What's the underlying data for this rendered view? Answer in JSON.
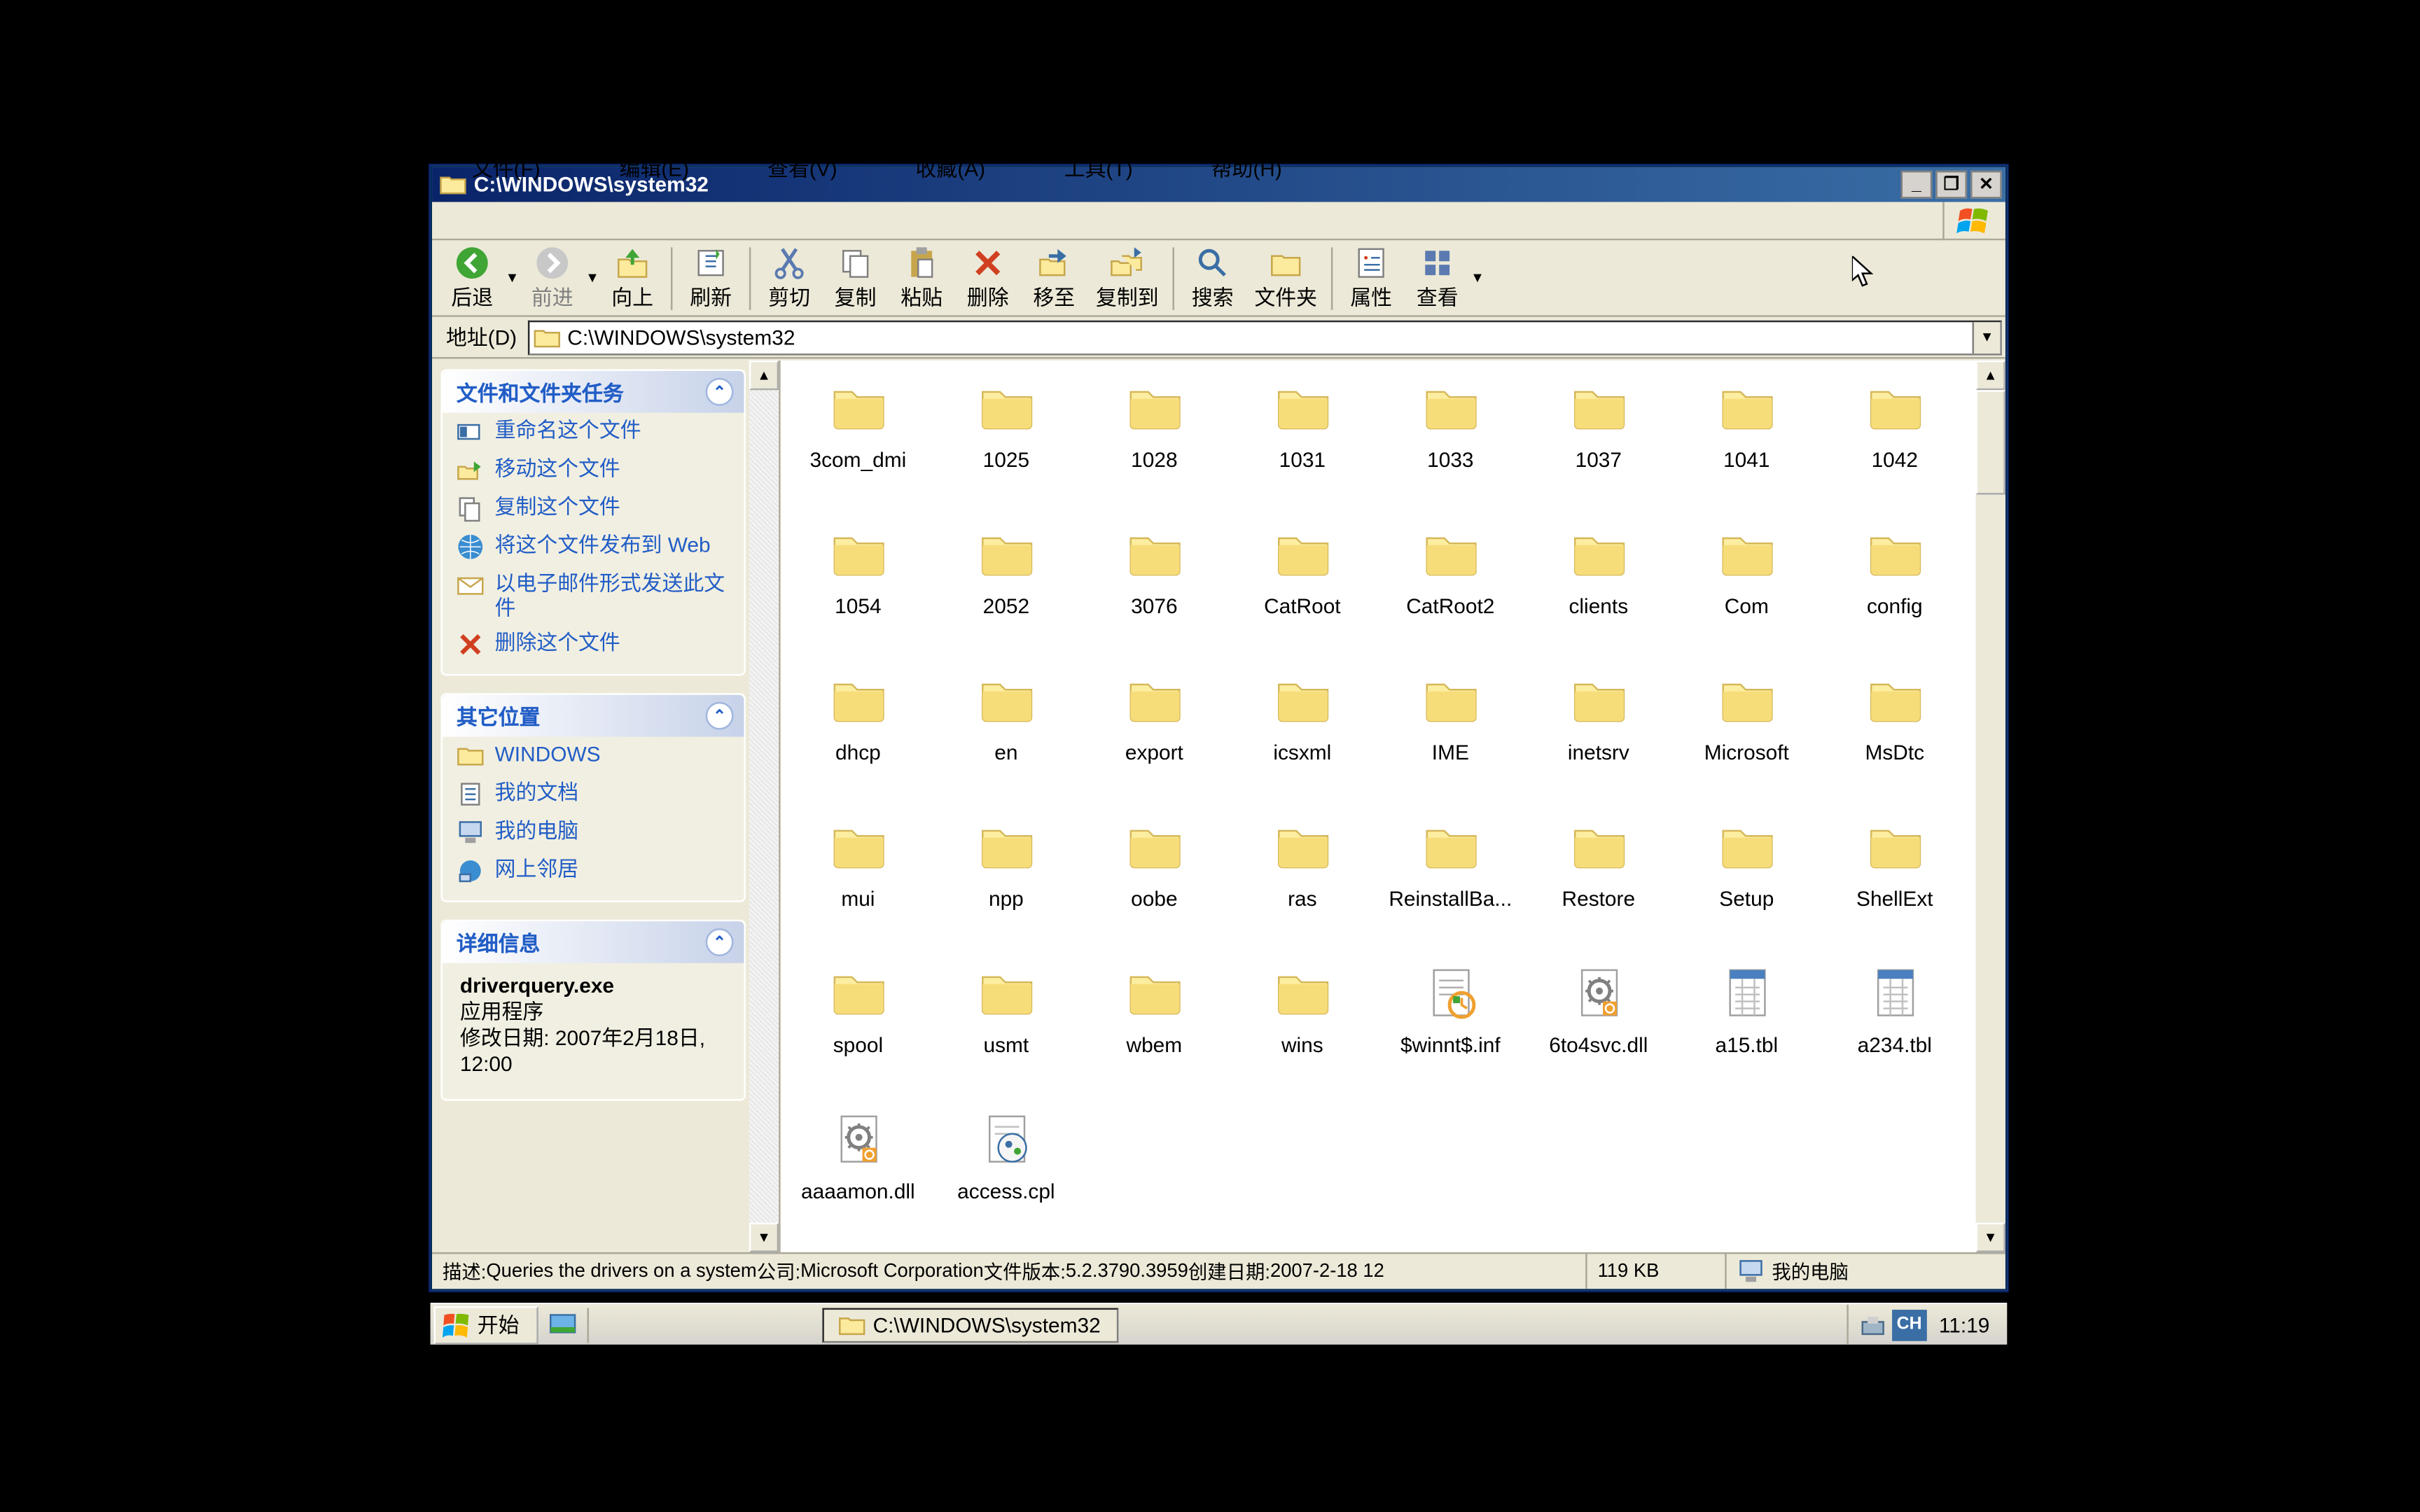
{
  "window": {
    "title": "C:\\WINDOWS\\system32"
  },
  "menu": {
    "file": "文件(F)",
    "edit": "编辑(E)",
    "view": "查看(V)",
    "favorites": "收藏(A)",
    "tools": "工具(T)",
    "help": "帮助(H)"
  },
  "toolbar": {
    "back": "后退",
    "forward": "前进",
    "up": "向上",
    "refresh": "刷新",
    "cut": "剪切",
    "copy": "复制",
    "paste": "粘贴",
    "delete": "删除",
    "moveto": "移至",
    "copyto": "复制到",
    "search": "搜索",
    "folders": "文件夹",
    "properties": "属性",
    "views": "查看"
  },
  "address": {
    "label": "地址(D)",
    "value": "C:\\WINDOWS\\system32"
  },
  "sidebar": {
    "tasks": {
      "title": "文件和文件夹任务",
      "items": [
        "重命名这个文件",
        "移动这个文件",
        "复制这个文件",
        "将这个文件发布到 Web",
        "以电子邮件形式发送此文件",
        "删除这个文件"
      ]
    },
    "places": {
      "title": "其它位置",
      "items": [
        "WINDOWS",
        "我的文档",
        "我的电脑",
        "网上邻居"
      ]
    },
    "details": {
      "title": "详细信息",
      "filename": "driverquery.exe",
      "filetype": "应用程序",
      "modified_label": "修改日期: ",
      "modified": "2007年2月18日, 12:00"
    }
  },
  "folders": [
    {
      "name": "3com_dmi",
      "type": "folder"
    },
    {
      "name": "1025",
      "type": "folder"
    },
    {
      "name": "1028",
      "type": "folder"
    },
    {
      "name": "1031",
      "type": "folder"
    },
    {
      "name": "1033",
      "type": "folder"
    },
    {
      "name": "1037",
      "type": "folder"
    },
    {
      "name": "1041",
      "type": "folder"
    },
    {
      "name": "1042",
      "type": "folder"
    },
    {
      "name": "1054",
      "type": "folder"
    },
    {
      "name": "2052",
      "type": "folder"
    },
    {
      "name": "3076",
      "type": "folder"
    },
    {
      "name": "CatRoot",
      "type": "folder"
    },
    {
      "name": "CatRoot2",
      "type": "folder"
    },
    {
      "name": "clients",
      "type": "folder"
    },
    {
      "name": "Com",
      "type": "folder"
    },
    {
      "name": "config",
      "type": "folder"
    },
    {
      "name": "dhcp",
      "type": "folder"
    },
    {
      "name": "en",
      "type": "folder"
    },
    {
      "name": "export",
      "type": "folder"
    },
    {
      "name": "icsxml",
      "type": "folder"
    },
    {
      "name": "IME",
      "type": "folder"
    },
    {
      "name": "inetsrv",
      "type": "folder"
    },
    {
      "name": "Microsoft",
      "type": "folder"
    },
    {
      "name": "MsDtc",
      "type": "folder"
    },
    {
      "name": "mui",
      "type": "folder"
    },
    {
      "name": "npp",
      "type": "folder"
    },
    {
      "name": "oobe",
      "type": "folder"
    },
    {
      "name": "ras",
      "type": "folder"
    },
    {
      "name": "ReinstallBa...",
      "type": "folder"
    },
    {
      "name": "Restore",
      "type": "folder"
    },
    {
      "name": "Setup",
      "type": "folder"
    },
    {
      "name": "ShellExt",
      "type": "folder"
    },
    {
      "name": "spool",
      "type": "folder"
    },
    {
      "name": "usmt",
      "type": "folder"
    },
    {
      "name": "wbem",
      "type": "folder"
    },
    {
      "name": "wins",
      "type": "folder"
    },
    {
      "name": "$winnt$.inf",
      "type": "inf"
    },
    {
      "name": "6to4svc.dll",
      "type": "dll"
    },
    {
      "name": "a15.tbl",
      "type": "tbl"
    },
    {
      "name": "a234.tbl",
      "type": "tbl"
    },
    {
      "name": "aaaamon.dll",
      "type": "dll"
    },
    {
      "name": "access.cpl",
      "type": "cpl"
    }
  ],
  "statusbar": {
    "desc_label": "描述: ",
    "desc": "Queries the drivers on a system",
    "company_label": " 公司: ",
    "company": "Microsoft Corporation",
    "version_label": " 文件版本: ",
    "version": "5.2.3790.3959",
    "created_label": " 创建日期: ",
    "created": "2007-2-18 12",
    "size": "119 KB",
    "location": "我的电脑"
  },
  "taskbar": {
    "start": "开始",
    "task1": "C:\\WINDOWS\\system32",
    "ime": "CH",
    "clock": "11:19"
  }
}
